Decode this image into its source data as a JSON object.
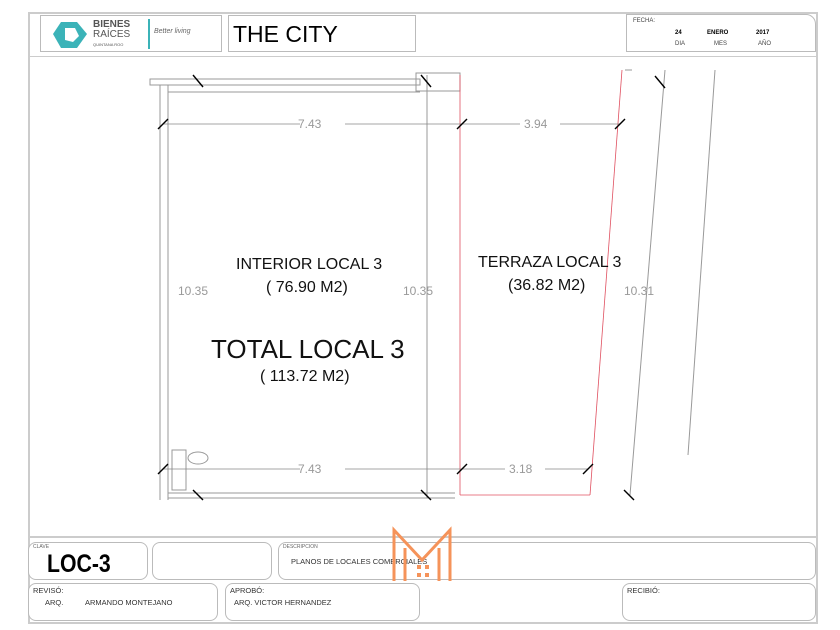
{
  "header": {
    "brand_line1": "BIENES",
    "brand_line2": "RAÍCES",
    "brand_sub": "QUINTANA ROO",
    "brand_tagline": "Better living",
    "project_title": "THE CITY",
    "fecha_label": "FECHA:",
    "dia": "24",
    "mes": "ENERO",
    "anio": "2017",
    "dia_label": "DIA",
    "mes_label": "MES",
    "anio_label": "AÑO"
  },
  "plan": {
    "dim_top_interior": "7.43",
    "dim_top_terraza": "3.94",
    "dim_bottom_interior": "7.43",
    "dim_bottom_terraza": "3.18",
    "dim_left": "10.35",
    "dim_middle": "10.35",
    "dim_right": "10.31",
    "interior_label": "INTERIOR LOCAL 3",
    "interior_area": "( 76.90 M2)",
    "terraza_label": "TERRAZA LOCAL 3",
    "terraza_area": "(36.82 M2)",
    "total_label": "TOTAL LOCAL 3",
    "total_area": "( 113.72 M2)"
  },
  "footer": {
    "clave_label": "CLAVE",
    "clave": "LOC-3",
    "descripcion_label": "DESCRIPCION",
    "descripcion": "PLANOS DE LOCALES COMERCIALES",
    "reviso_label": "REVISÓ:",
    "reviso_title": "ARQ.",
    "reviso_name": "ARMANDO MONTEJANO",
    "aprobo_label": "APROBÓ:",
    "aprobo_name": "ARQ. VICTOR HERNANDEZ",
    "recibio_label": "RECIBIÓ:"
  },
  "colors": {
    "accent": "#3bb3b8",
    "red_line": "#e05060",
    "watermark": "#f5935a"
  }
}
